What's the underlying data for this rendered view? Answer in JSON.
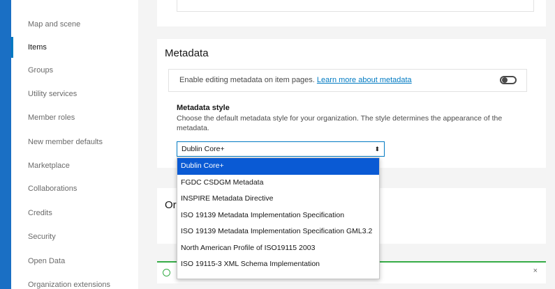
{
  "sidebar": {
    "items": [
      {
        "label": "Map and scene"
      },
      {
        "label": "Items"
      },
      {
        "label": "Groups"
      },
      {
        "label": "Utility services"
      },
      {
        "label": "Member roles"
      },
      {
        "label": "New member defaults"
      },
      {
        "label": "Marketplace"
      },
      {
        "label": "Collaborations"
      },
      {
        "label": "Credits"
      },
      {
        "label": "Security"
      },
      {
        "label": "Open Data"
      },
      {
        "label": "Organization extensions"
      }
    ],
    "active_index": 1
  },
  "metadata": {
    "title": "Metadata",
    "enable_text": "Enable editing metadata on item pages.",
    "learn_more": "Learn more about metadata",
    "style_label": "Metadata style",
    "style_desc": "Choose the default metadata style for your organization. The style determines the appearance of the metadata.",
    "selected": "Dublin Core+",
    "options": [
      "Dublin Core+",
      "FGDC CSDGM Metadata",
      "INSPIRE Metadata Directive",
      "ISO 19139 Metadata Implementation Specification",
      "ISO 19139 Metadata Implementation Specification GML3.2",
      "North American Profile of ISO19115 2003",
      "ISO 19115-3 XML Schema Implementation"
    ]
  },
  "lower_section": {
    "title_visible": "Or"
  },
  "notice": {
    "close": "×"
  },
  "colors": {
    "accent": "#007ac2",
    "selected_option": "#0a5ad4",
    "success": "#35ac46",
    "frame_bg": "#1a6fc4"
  }
}
